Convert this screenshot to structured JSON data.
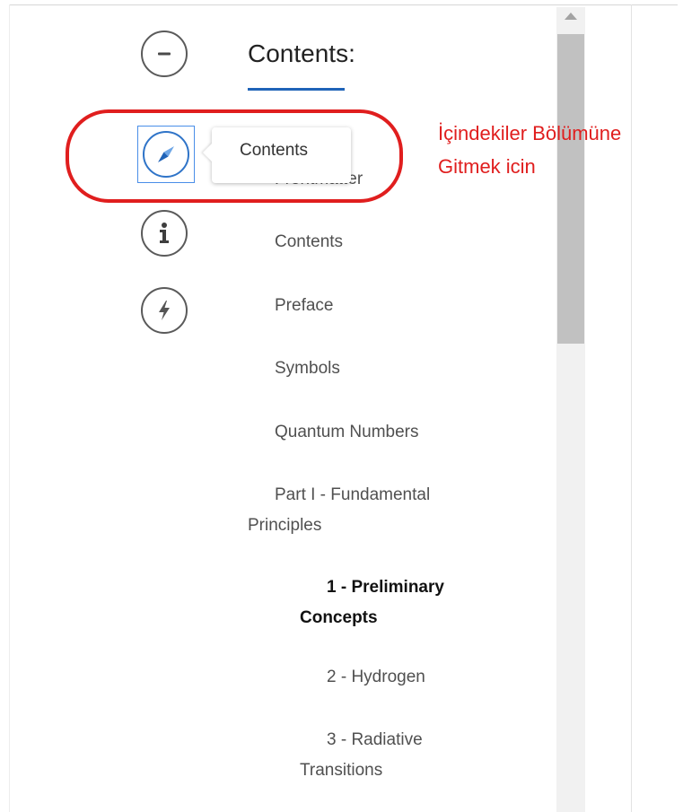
{
  "sidebar": {
    "title": "Contents:",
    "tooltip": "Contents",
    "toc": [
      {
        "label": "Frontmatter",
        "level": 0,
        "current": false
      },
      {
        "label": "Contents",
        "level": 0,
        "current": false
      },
      {
        "label": "Preface",
        "level": 0,
        "current": false
      },
      {
        "label": "Symbols",
        "level": 0,
        "current": false
      },
      {
        "label": "Quantum Numbers",
        "level": 0,
        "current": false
      },
      {
        "label": "Part I - Fundamental Principles",
        "level": 0,
        "current": false
      },
      {
        "label": "1 - Preliminary Concepts",
        "level": 1,
        "current": true
      },
      {
        "label": "2 - Hydrogen",
        "level": 1,
        "current": false
      },
      {
        "label": "3 - Radiative Transitions",
        "level": 1,
        "current": false
      }
    ]
  },
  "rail": {
    "buttons": [
      {
        "name": "collapse-button",
        "icon": "minus-icon"
      },
      {
        "name": "contents-button",
        "icon": "compass-icon"
      },
      {
        "name": "info-button",
        "icon": "info-icon"
      },
      {
        "name": "quick-access-button",
        "icon": "lightning-icon"
      }
    ]
  },
  "annotation": {
    "line1": "İçindekiler Bölümüne",
    "line2": "Gitmek icin"
  },
  "colors": {
    "accent": "#1f63b8",
    "annotation": "#e01e1e",
    "icon": "#5a5a5a"
  }
}
